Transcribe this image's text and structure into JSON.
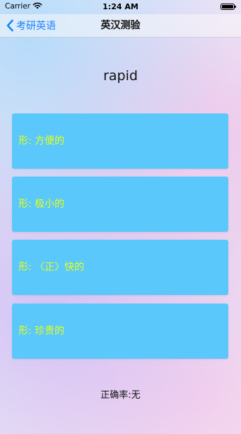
{
  "status_bar": {
    "carrier": "Carrier",
    "time": "1:24 AM",
    "icons": [
      "wifi-icon",
      "battery-icon"
    ]
  },
  "nav": {
    "back_label": "考研英语",
    "title": "英汉测验",
    "back_icon": "chevron-left-icon"
  },
  "quiz": {
    "word": "rapid",
    "options": [
      "形: 方便的",
      "形: 极小的",
      "形: 〈正〉快的",
      "形: 珍贵的"
    ],
    "accuracy": "正确率:无"
  },
  "colors": {
    "accent": "#1a82fb",
    "option_background": "#5ac8fa",
    "option_text": "#e6ff1a"
  }
}
